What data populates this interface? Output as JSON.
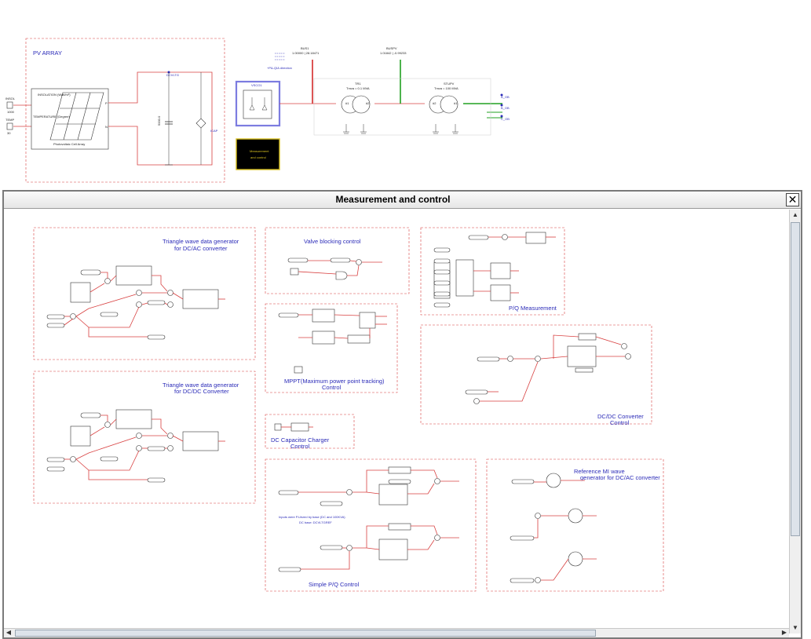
{
  "top": {
    "pv_array_label": "PV ARRAY",
    "insolation_label": "INSOLATION\n(Watt/m²)",
    "temperature_label": "TEMPERATURE\n(Degree)",
    "cell_array_label": "Photovoltaic Cell Array",
    "insol_input": "INSOL",
    "insol_value": "1000",
    "temp_input": "TEMP",
    "temp_value": "30",
    "dcvltg": "DCVLTG",
    "icap": "ICAP",
    "cap_value": "5000.0",
    "bus1_name": "BUS1",
    "bus1_values": "1.00000 | 28.18471",
    "bus_pv_name": "BUSPV",
    "bus_pv_values": "1.01842 | -0.99233",
    "p_q_dir": "+P&-QIA direction",
    "tr1_name": "TR1",
    "tr1_rating": "Tmva = 0.1 MVA",
    "stu_name": "STUPV",
    "stu_rating": "Tmva = 100 MVA",
    "vsc_label": "VSCO1",
    "meas_block_line1": "Measurement",
    "meas_block_line2": "and control",
    "phase_a": "A_OB",
    "phase_b": "B_OB",
    "phase_c": "C_OB"
  },
  "window": {
    "title": "Measurement and control",
    "close": "✕"
  },
  "blocks": {
    "tri_ac_title1": "Triangle wave data generator",
    "tri_ac_title2": "for DC/AC converter",
    "tri_dc_title1": "Triangle wave data generator",
    "tri_dc_title2": "for DC/DC Converter",
    "valve_title": "Valve blocking control",
    "pq_meas_title": "P/Q Measurement",
    "mppt_title1": "MPPT(Maximum power point tracking)",
    "mppt_title2": "Control",
    "dcdc_title1": "DC/DC Converter",
    "dcdc_title2": "Control",
    "dccap_title1": "DC Capacitor Charger",
    "dccap_title2": "Control",
    "simple_pq_title": "Simple P/Q Control",
    "ref_mi_title1": "Reference MI wave",
    "ref_mi_title2": "generator for DC/AC converter",
    "input_note1": "Inputs were P.Urized by base (DC and 100KVA)",
    "input_note2": "DC base: DCVLTGREF"
  },
  "colors": {
    "wire": "#d84040",
    "title": "#2b2bb8",
    "bus_green": "#20a020",
    "highlight": "#7c7ce0"
  }
}
